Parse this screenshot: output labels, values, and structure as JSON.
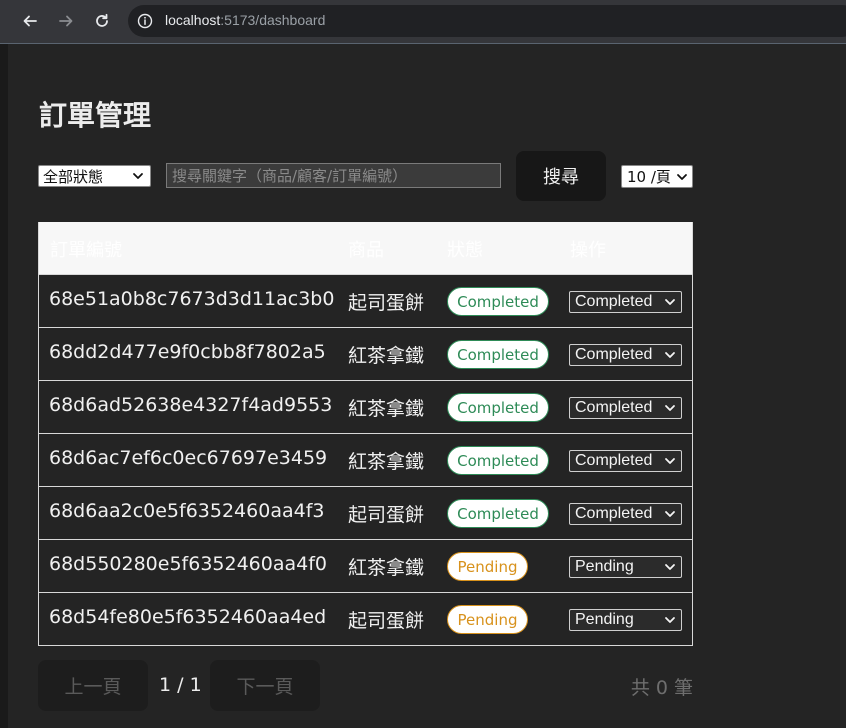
{
  "browser": {
    "url_host": "localhost",
    "url_rest": ":5173/dashboard"
  },
  "page": {
    "title": "訂單管理"
  },
  "filters": {
    "status_selected": "全部狀態",
    "search_placeholder": "搜尋關鍵字（商品/顧客/訂單編號）",
    "search_button": "搜尋",
    "page_size_selected": "10 /頁"
  },
  "table": {
    "headers": [
      "訂單編號",
      "商品",
      "狀態",
      "操作"
    ],
    "rows": [
      {
        "id": "68e51a0b8c7673d3d11ac3b0",
        "product": "起司蛋餅",
        "status": "Completed",
        "action": "Completed"
      },
      {
        "id": "68dd2d477e9f0cbb8f7802a5",
        "product": "紅茶拿鐵",
        "status": "Completed",
        "action": "Completed"
      },
      {
        "id": "68d6ad52638e4327f4ad9553",
        "product": "紅茶拿鐵",
        "status": "Completed",
        "action": "Completed"
      },
      {
        "id": "68d6ac7ef6c0ec67697e3459",
        "product": "紅茶拿鐵",
        "status": "Completed",
        "action": "Completed"
      },
      {
        "id": "68d6aa2c0e5f6352460aa4f3",
        "product": "起司蛋餅",
        "status": "Completed",
        "action": "Completed"
      },
      {
        "id": "68d550280e5f6352460aa4f0",
        "product": "紅茶拿鐵",
        "status": "Pending",
        "action": "Pending"
      },
      {
        "id": "68d54fe80e5f6352460aa4ed",
        "product": "起司蛋餅",
        "status": "Pending",
        "action": "Pending"
      }
    ]
  },
  "pagination": {
    "prev_label": "上一頁",
    "page_info": "1 / 1",
    "next_label": "下一頁",
    "total": "共 0 筆"
  },
  "colors": {
    "completed": "#2e8b57",
    "pending": "#d8921c"
  }
}
